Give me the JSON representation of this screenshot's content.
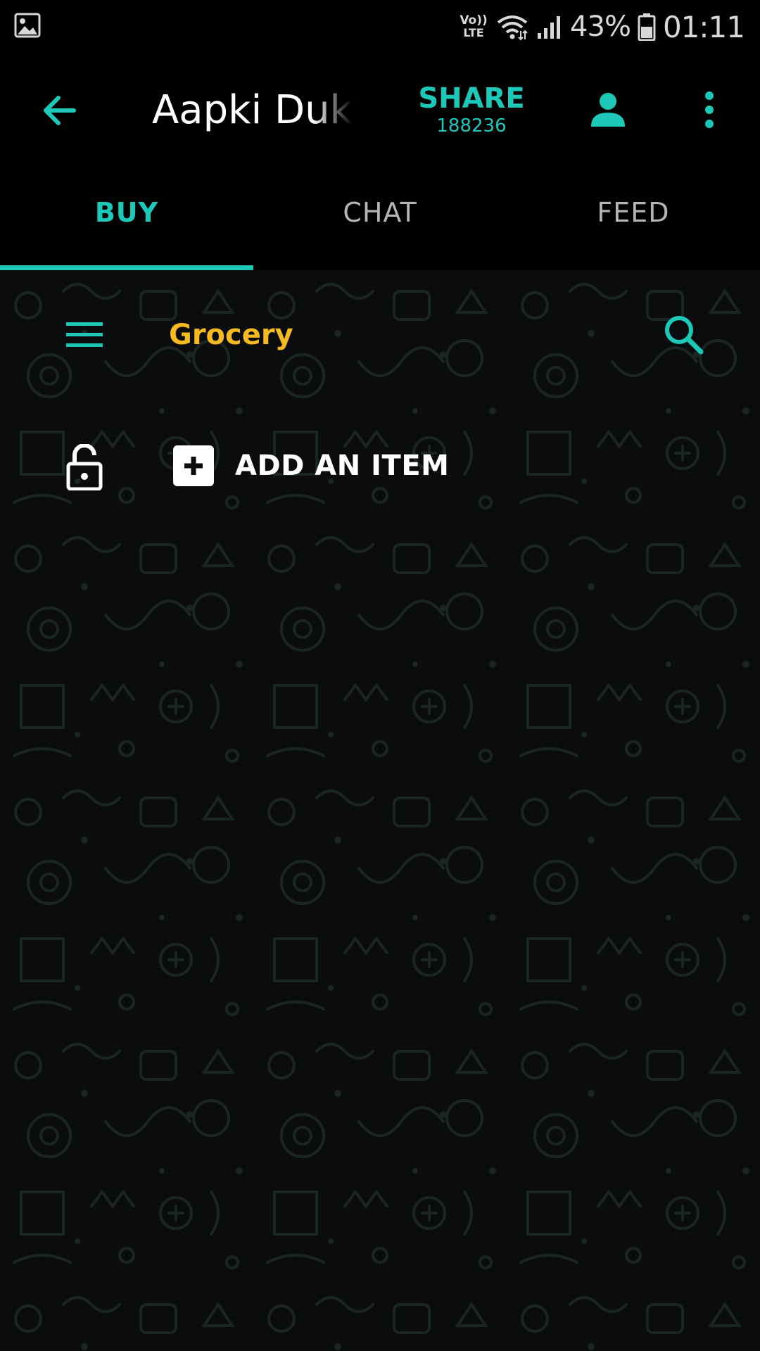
{
  "status_bar": {
    "network_top": "Vo))",
    "network_bottom": "LTE",
    "battery_percent": "43%",
    "time": "01:11",
    "icons": [
      "gallery-icon",
      "volte-icon",
      "wifi-icon",
      "signal-icon",
      "battery-icon"
    ]
  },
  "app_bar": {
    "title": "Aapki Dukaan",
    "share_label": "SHARE",
    "share_count": "188236",
    "icons": [
      "back-arrow-icon",
      "person-icon",
      "more-vert-icon"
    ]
  },
  "tabs": [
    {
      "label": "BUY",
      "active": true
    },
    {
      "label": "CHAT",
      "active": false
    },
    {
      "label": "FEED",
      "active": false
    }
  ],
  "category": {
    "title": "Grocery",
    "icons": [
      "menu-icon",
      "search-icon"
    ]
  },
  "actions": {
    "add_item_label": "ADD AN ITEM",
    "icons": [
      "lock-open-icon",
      "add-box-icon"
    ]
  },
  "colors": {
    "accent": "#1ec8b8",
    "category_title": "#f5b921",
    "background": "#000000",
    "content_background": "#0a0c0d",
    "doodle": "#1a2624"
  }
}
